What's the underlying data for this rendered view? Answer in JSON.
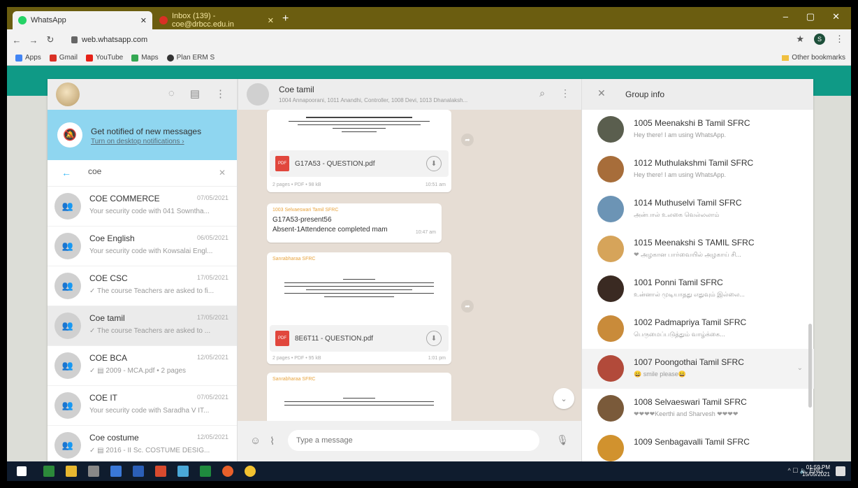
{
  "browser": {
    "tabs": [
      {
        "label": "WhatsApp",
        "active": true
      },
      {
        "label": "Inbox (139) - coe@drbcc.edu.in",
        "active": false
      }
    ],
    "url": "web.whatsapp.com",
    "bookmarks": [
      {
        "label": "Apps",
        "color": "#4285f4"
      },
      {
        "label": "Gmail",
        "color": "#d93025"
      },
      {
        "label": "YouTube",
        "color": "#e62117"
      },
      {
        "label": "Maps",
        "color": "#34a853"
      },
      {
        "label": "Plan ERM S",
        "color": "#333333"
      }
    ],
    "other_bookmarks": "Other bookmarks",
    "profile_letter": "S"
  },
  "sidebar": {
    "notification": {
      "title": "Get notified of new messages",
      "link": "Turn on desktop notifications ›"
    },
    "search": {
      "value": "coe"
    },
    "chats": [
      {
        "name": "COE COMMERCE",
        "time": "07/05/2021",
        "preview": "Your security code with 041 Sowntha...",
        "selected": false
      },
      {
        "name": "Coe English",
        "time": "06/05/2021",
        "preview": "Your security code with Kowsalai Engl...",
        "selected": false
      },
      {
        "name": "COE CSC",
        "time": "17/05/2021",
        "preview": "✓ The course Teachers are asked to fi...",
        "selected": false
      },
      {
        "name": "Coe tamil",
        "time": "17/05/2021",
        "preview": "✓ The course Teachers are asked to ...",
        "selected": true
      },
      {
        "name": "COE BCA",
        "time": "12/05/2021",
        "preview": "✓ ▤ 2009 - MCA.pdf • 2 pages",
        "selected": false
      },
      {
        "name": "COE IT",
        "time": "07/05/2021",
        "preview": "Your security code with Saradha V IT...",
        "selected": false
      },
      {
        "name": "Coe costume",
        "time": "12/05/2021",
        "preview": "✓ ▤ 2016 - II Sc. COSTUME DESIG...",
        "selected": false
      }
    ]
  },
  "conversation": {
    "title": "Coe tamil",
    "members": "1004 Annapoorani, 1011 Anandhi, Controller, 1008 Devi, 1013 Dhanalaksh...",
    "messages": [
      {
        "type": "doc",
        "file": "G17A53 - QUESTION.pdf",
        "meta": "2 pages • PDF • 98 kB",
        "time": "10:51 am"
      },
      {
        "type": "text",
        "sender": "1003 Selvaeswari Tamil SFRC",
        "lines": [
          "G17A53-present56",
          "Absent-1Attendence completed mam"
        ],
        "time": "10:47 am"
      },
      {
        "type": "doc",
        "sender": "Sanrabharaa SFRC",
        "file": "8E6T11 - QUESTION.pdf",
        "meta": "2 pages • PDF • 95 kB",
        "time": "1:01 pm"
      },
      {
        "type": "doc",
        "sender": "Sanrabharaa SFRC"
      }
    ],
    "compose_placeholder": "Type a message"
  },
  "group_info": {
    "title": "Group info",
    "members": [
      {
        "name": "1005 Meenakshi B Tamil SFRC",
        "about": "Hey there! I am using WhatsApp.",
        "color": "#5a5e4e"
      },
      {
        "name": "1012 Muthulakshmi Tamil SFRC",
        "about": "Hey there! I am using WhatsApp.",
        "color": "#a76d3a"
      },
      {
        "name": "1014 Muthuselvi Tamil SFRC",
        "about": "அன்பால் உலகை வெல்லலாம்",
        "color": "#6c94b5"
      },
      {
        "name": "1015 Meenakshi S TAMIL SFRC",
        "about": "❤ அழகான பார்வையில் அழகாய் சி...",
        "color": "#d6a45a"
      },
      {
        "name": "1001 Ponni Tamil SFRC",
        "about": "உன்னால் முடியாதது எதுவும் இல்லை...",
        "color": "#3a2a22"
      },
      {
        "name": "1002 Padmapriya Tamil SFRC",
        "about": "பெருமைப்படுத்தும் வாழ்க்கை...",
        "color": "#c98b3a"
      },
      {
        "name": "1007 Poongothai Tamil SFRC",
        "about": "😀 smile please😀",
        "color": "#b24a3a",
        "hover": true
      },
      {
        "name": "1008 Selvaeswari Tamil SFRC",
        "about": "❤❤❤❤Keerthi and Sharvesh ❤❤❤❤",
        "color": "#7a5a3a"
      },
      {
        "name": "1009 Senbagavalli Tamil SFRC",
        "about": "",
        "color": "#d1922e"
      }
    ]
  },
  "taskbar": {
    "tray": "^ ☐ 🔈 ENG",
    "time": "01:59 PM",
    "date": "15/05/2021"
  }
}
